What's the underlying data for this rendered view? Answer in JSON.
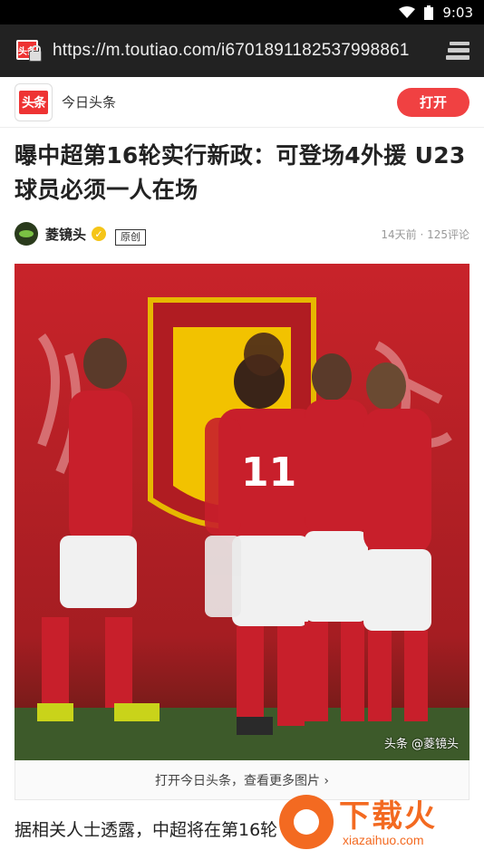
{
  "status_bar": {
    "time": "9:03",
    "wifi_icon": "wifi-icon",
    "battery_icon": "battery-icon"
  },
  "browser": {
    "url": "https://m.toutiao.com/i6701891182537998861",
    "site_icon": "toutiao-lock-icon",
    "tabs_icon": "tabs-stack-icon"
  },
  "app_banner": {
    "logo_text": "头条",
    "app_name": "今日头条",
    "open_label": "打开",
    "accent": "#f04142"
  },
  "article": {
    "headline": "曝中超第16轮实行新政：可登场4外援 U23球员必须一人在场",
    "author": "菱镜头",
    "badge": "原创",
    "time_comments": "14天前 · 125评论",
    "photo_watermark": "头条 @菱镜头",
    "more_photos_label": "打开今日头条，查看更多图片 ›",
    "body_preview": "据相关人士透露，中超将在第16轮"
  },
  "overlay": {
    "brand": "下载火",
    "domain": "xiazaihuo.com",
    "color": "#f36a21"
  }
}
